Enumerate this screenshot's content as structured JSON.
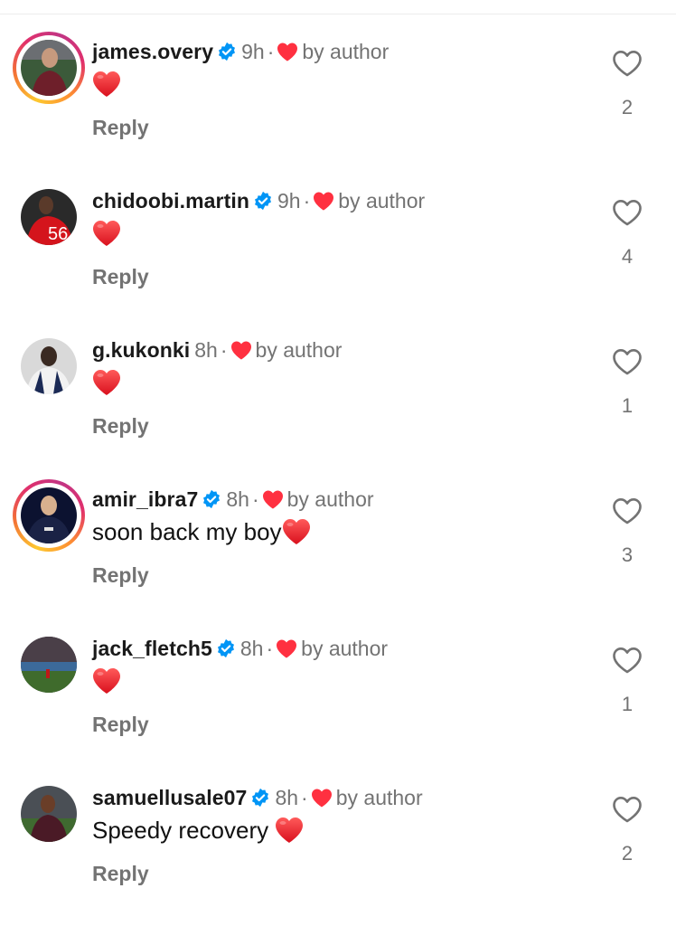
{
  "colors": {
    "verified_blue": "#0095f6",
    "heart_red": "#ff3040",
    "secondary_text": "#737373"
  },
  "comments": [
    {
      "username": "james.overy",
      "verified": true,
      "time": "9h",
      "liked_by": "by author",
      "text": "",
      "emoji_heart": true,
      "reply": "Reply",
      "likes": "2",
      "story_ring": true
    },
    {
      "username": "chidoobi.martin",
      "verified": true,
      "time": "9h",
      "liked_by": "by author",
      "text": "",
      "emoji_heart": true,
      "reply": "Reply",
      "likes": "4",
      "story_ring": false
    },
    {
      "username": "g.kukonki",
      "verified": false,
      "time": "8h",
      "liked_by": "by author",
      "text": "",
      "emoji_heart": true,
      "reply": "Reply",
      "likes": "1",
      "story_ring": false
    },
    {
      "username": "amir_ibra7",
      "verified": true,
      "time": "8h",
      "liked_by": "by author",
      "text": "soon back my boy",
      "emoji_heart": true,
      "reply": "Reply",
      "likes": "3",
      "story_ring": true
    },
    {
      "username": "jack_fletch5",
      "verified": true,
      "time": "8h",
      "liked_by": "by author",
      "text": "",
      "emoji_heart": true,
      "reply": "Reply",
      "likes": "1",
      "story_ring": false
    },
    {
      "username": "samuellusale07",
      "verified": true,
      "time": "8h",
      "liked_by": "by author",
      "text": "Speedy recovery ",
      "emoji_heart": true,
      "reply": "Reply",
      "likes": "2",
      "story_ring": false
    }
  ]
}
